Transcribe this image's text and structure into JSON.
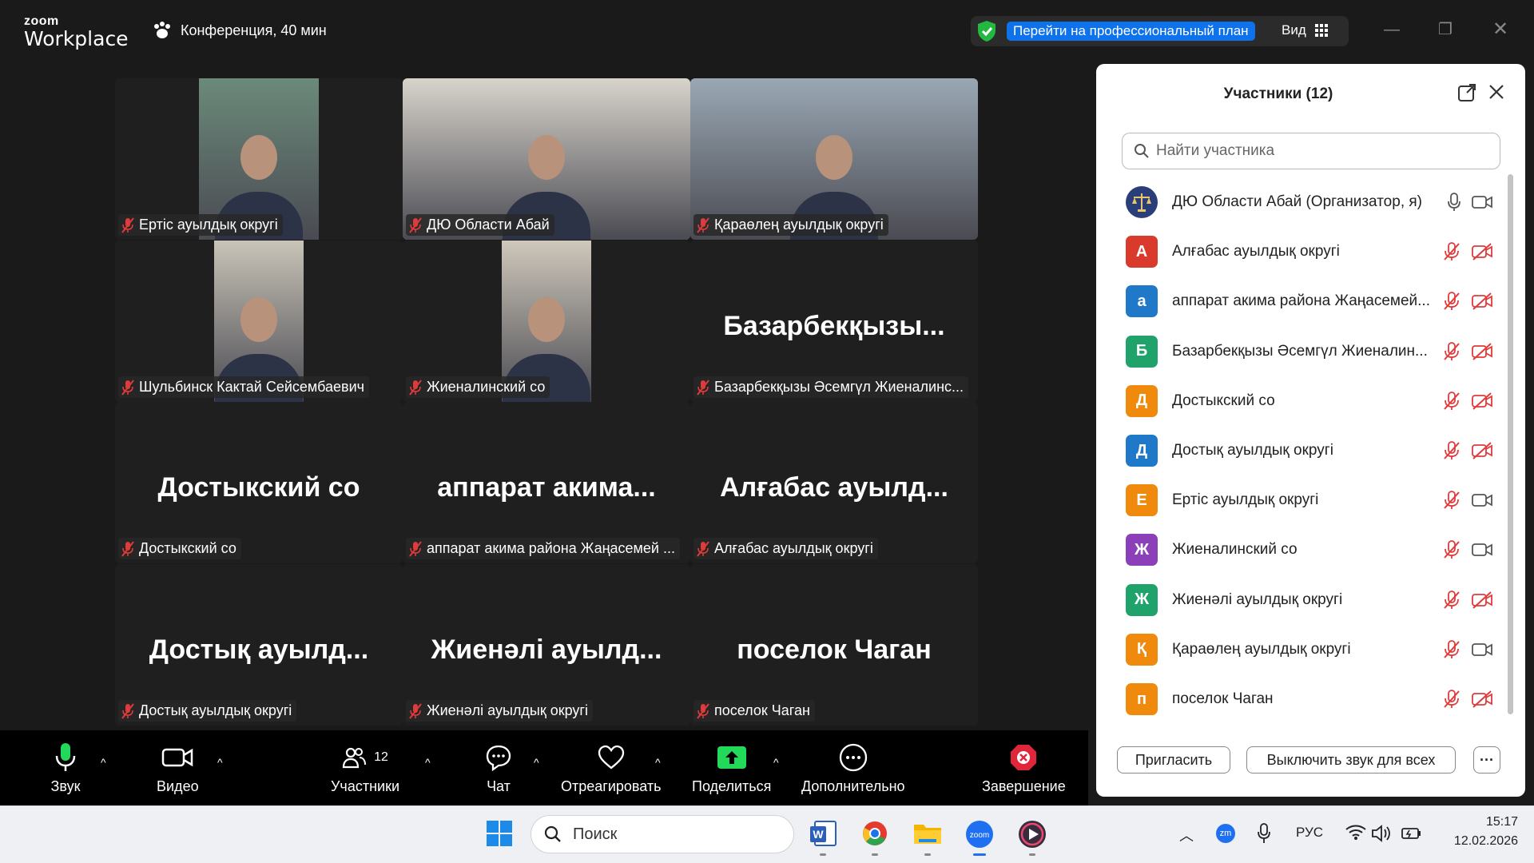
{
  "titlebar": {
    "logo_small": "zoom",
    "logo_big": "Workplace",
    "meeting": "Конференция, 40 мин",
    "upgrade": "Перейти на профессиональный план",
    "view": "Вид"
  },
  "tiles": [
    {
      "name": "Ертіс ауылдық округі",
      "big": "",
      "video": true,
      "active": false,
      "photo_color": "#6b8a7a"
    },
    {
      "name": "ДЮ Области Абай",
      "big": "",
      "video": true,
      "active": true,
      "photo_color": "#d8d4cc"
    },
    {
      "name": "Қараөлең ауылдық округі",
      "big": "",
      "video": true,
      "active": false,
      "photo_color": "#9aa8b4"
    },
    {
      "name": "Шульбинск Кактай Сейсембаевич",
      "big": "",
      "video": true,
      "active": false,
      "photo_color": "#c9c4b8"
    },
    {
      "name": "Жиеналинский со",
      "big": "",
      "video": true,
      "active": false,
      "photo_color": "#cfc8bb"
    },
    {
      "name": "Базарбекқызы Әсемгүл Жиеналинс...",
      "big": "Базарбекқызы...",
      "video": false,
      "active": false
    },
    {
      "name": "Достыкский со",
      "big": "Достыкский со",
      "video": false,
      "active": false
    },
    {
      "name": "аппарат акима района Жаңасемей ...",
      "big": "аппарат  акима...",
      "video": false,
      "active": false
    },
    {
      "name": "Алғабас ауылдық округі",
      "big": "Алғабас  ауылд...",
      "video": false,
      "active": false
    },
    {
      "name": "Достық ауылдық округі",
      "big": "Достық ауылд...",
      "video": false,
      "active": false
    },
    {
      "name": "Жиенәлі ауылдық округі",
      "big": "Жиенәлі ауылд...",
      "video": false,
      "active": false
    },
    {
      "name": "поселок Чаган",
      "big": "поселок Чаган",
      "video": false,
      "active": false
    }
  ],
  "toolbar": {
    "audio": "Звук",
    "video": "Видео",
    "participants": "Участники",
    "participants_count": "12",
    "chat": "Чат",
    "react": "Отреагировать",
    "share": "Поделиться",
    "more": "Дополнительно",
    "end": "Завершение"
  },
  "panel": {
    "title": "Участники (12)",
    "search_placeholder": "Найти участника",
    "invite": "Пригласить",
    "mute_all": "Выключить звук для всех",
    "participants": [
      {
        "initial": "",
        "name": "ДЮ Области Абай (Организатор, я)",
        "color": "#2a3f7a",
        "mic": "on",
        "cam": "on"
      },
      {
        "initial": "А",
        "name": "Алғабас ауылдық округі",
        "color": "#d93a2b",
        "mic": "off",
        "cam": "off"
      },
      {
        "initial": "а",
        "name": "аппарат акима района Жаңасемей...",
        "color": "#1f78c8",
        "mic": "off",
        "cam": "off"
      },
      {
        "initial": "Б",
        "name": "Базарбекқызы Әсемгүл Жиеналин...",
        "color": "#1fa36b",
        "mic": "off",
        "cam": "off"
      },
      {
        "initial": "Д",
        "name": "Достыкский со",
        "color": "#f08a0c",
        "mic": "off",
        "cam": "off"
      },
      {
        "initial": "Д",
        "name": "Достық ауылдық округі",
        "color": "#1f78c8",
        "mic": "off",
        "cam": "off"
      },
      {
        "initial": "Е",
        "name": "Ертіс ауылдық округі",
        "color": "#f08a0c",
        "mic": "off",
        "cam": "on"
      },
      {
        "initial": "Ж",
        "name": "Жиеналинский со",
        "color": "#8b3fb8",
        "mic": "off",
        "cam": "on"
      },
      {
        "initial": "Ж",
        "name": "Жиенәлі ауылдық округі",
        "color": "#1fa36b",
        "mic": "off",
        "cam": "off"
      },
      {
        "initial": "Қ",
        "name": "Қараөлең ауылдық округі",
        "color": "#f08a0c",
        "mic": "off",
        "cam": "on"
      },
      {
        "initial": "п",
        "name": "поселок Чаган",
        "color": "#f08a0c",
        "mic": "off",
        "cam": "off"
      }
    ]
  },
  "taskbar": {
    "search": "Поиск",
    "lang": "РУС",
    "time": "15:17",
    "date": "12.02.2026",
    "zm": "zm"
  }
}
